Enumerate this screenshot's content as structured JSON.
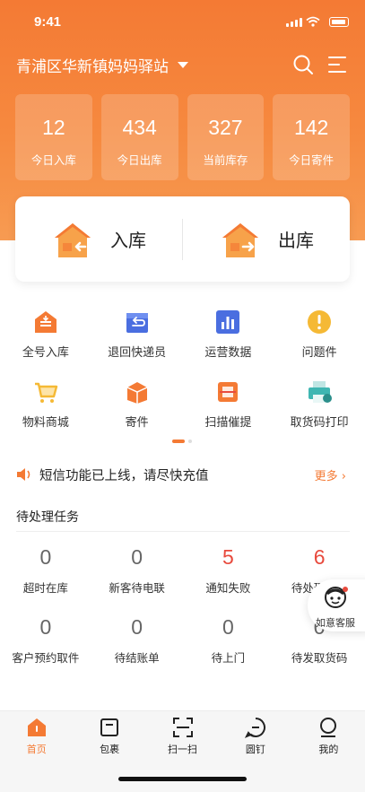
{
  "status_bar": {
    "time": "9:41"
  },
  "header": {
    "station_name": "青浦区华新镇妈妈驿站",
    "icons": [
      "search-icon",
      "menu-icon",
      "chevron-down-icon"
    ]
  },
  "stats": [
    {
      "value": "12",
      "label": "今日入库"
    },
    {
      "value": "434",
      "label": "今日出库"
    },
    {
      "value": "327",
      "label": "当前库存"
    },
    {
      "value": "142",
      "label": "今日寄件"
    }
  ],
  "io": {
    "in_label": "入库",
    "out_label": "出库"
  },
  "functions": [
    {
      "label": "全号入库",
      "icon": "box-in-icon"
    },
    {
      "label": "退回快递员",
      "icon": "return-box-icon"
    },
    {
      "label": "运营数据",
      "icon": "bar-chart-icon"
    },
    {
      "label": "问题件",
      "icon": "warning-icon"
    },
    {
      "label": "物料商城",
      "icon": "cart-icon"
    },
    {
      "label": "寄件",
      "icon": "send-box-icon"
    },
    {
      "label": "扫描催提",
      "icon": "scan-remind-icon"
    },
    {
      "label": "取货码打印",
      "icon": "printer-icon"
    }
  ],
  "notice": {
    "message": "短信功能已上线，请尽快充值",
    "more": "更多"
  },
  "pending": {
    "title": "待处理任务",
    "items": [
      {
        "count": "0",
        "label": "超时在库",
        "highlight": false
      },
      {
        "count": "0",
        "label": "新客待电联",
        "highlight": false
      },
      {
        "count": "5",
        "label": "通知失败",
        "highlight": true
      },
      {
        "count": "6",
        "label": "待处理投诉",
        "highlight": true
      },
      {
        "count": "0",
        "label": "客户预约取件",
        "highlight": false
      },
      {
        "count": "0",
        "label": "待结账单",
        "highlight": false
      },
      {
        "count": "0",
        "label": "待上门",
        "highlight": false
      },
      {
        "count": "0",
        "label": "待发取货码",
        "highlight": false
      }
    ]
  },
  "customer_service": {
    "label": "如意客服"
  },
  "tabbar": [
    {
      "label": "首页",
      "icon": "home-icon",
      "active": true
    },
    {
      "label": "包裹",
      "icon": "package-icon",
      "active": false
    },
    {
      "label": "扫一扫",
      "icon": "scan-icon",
      "active": false
    },
    {
      "label": "圆钉",
      "icon": "chat-icon",
      "active": false
    },
    {
      "label": "我的",
      "icon": "profile-icon",
      "active": false
    }
  ],
  "colors": {
    "brand": "#f47a34",
    "alert": "#e84a3d",
    "blue": "#4a6ee0",
    "yellow": "#f5b935",
    "teal": "#3fb6b2"
  }
}
